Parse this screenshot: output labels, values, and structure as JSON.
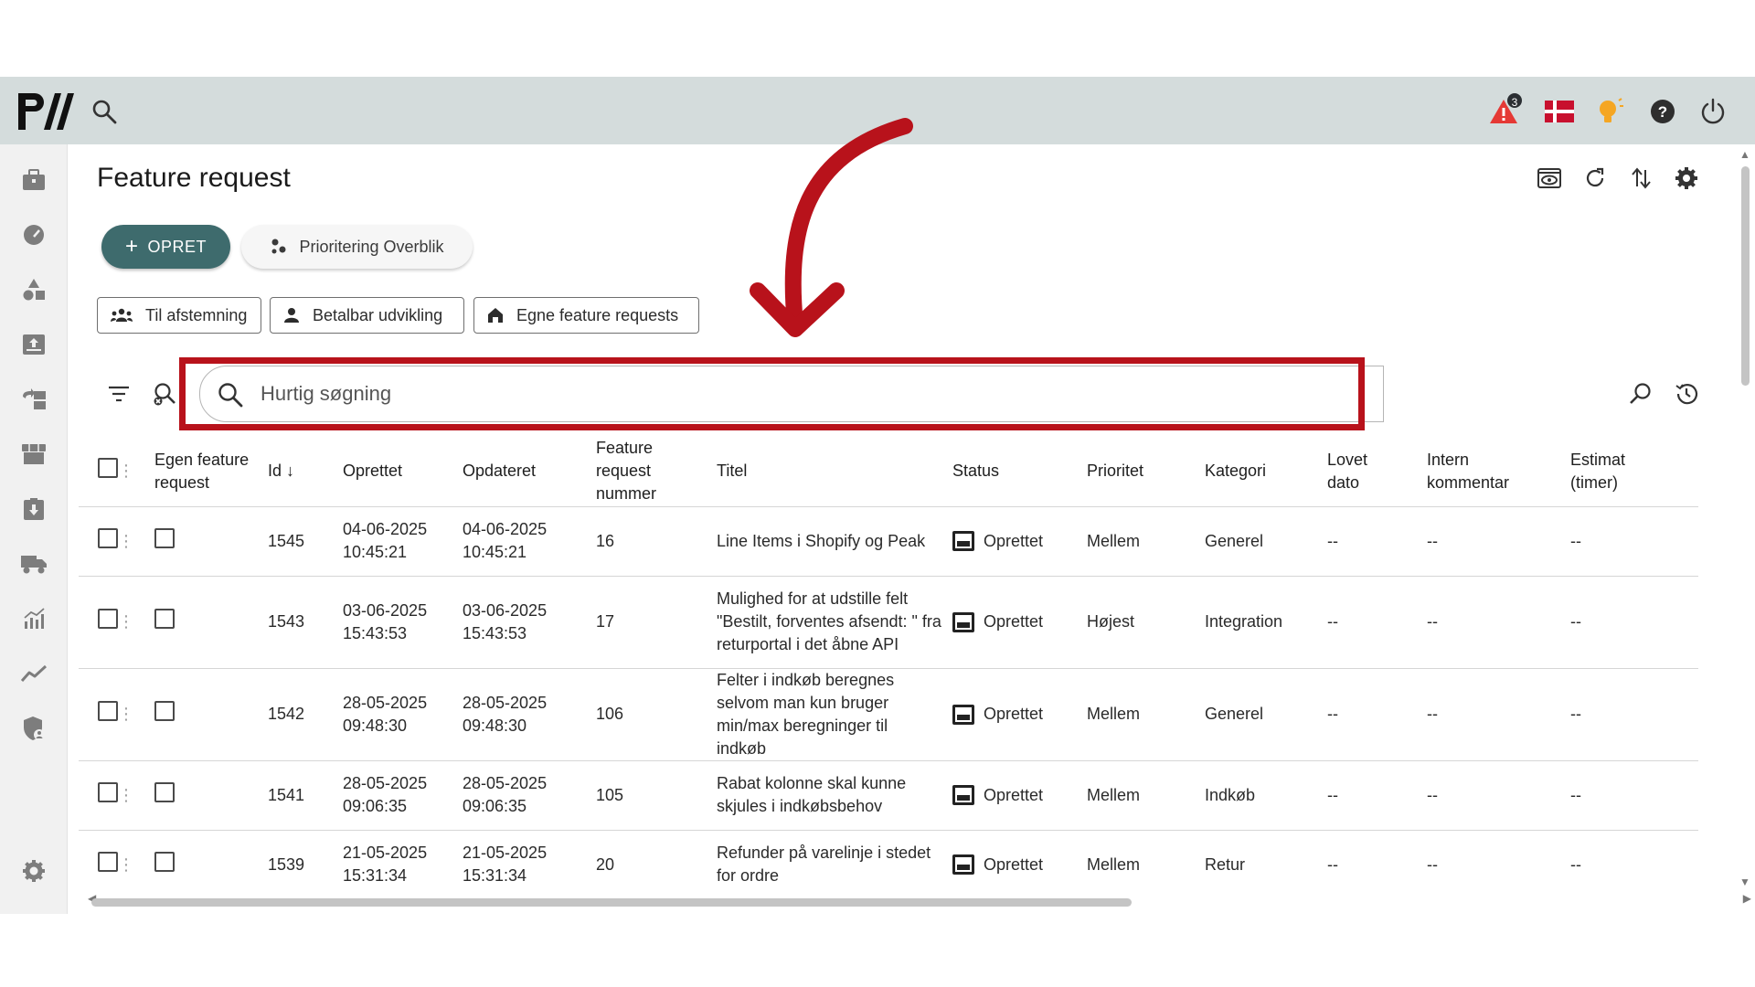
{
  "app": {
    "logo_text": "PW"
  },
  "topbar": {
    "notifications": {
      "count": "3"
    },
    "language": "Danish flag",
    "colors": {
      "bar": "#d4dcdc",
      "alert": "#e53935",
      "bulb": "#f5a623"
    }
  },
  "page": {
    "title": "Feature request"
  },
  "actions": {
    "create_label": "OPRET",
    "overview_label": "Prioritering Overblik"
  },
  "chips": [
    {
      "label": "Til afstemning"
    },
    {
      "label": "Betalbar udvikling"
    },
    {
      "label": "Egne feature requests"
    }
  ],
  "search": {
    "placeholder": "Hurtig søgning",
    "value": ""
  },
  "table": {
    "columns": [
      "Egen feature request",
      "Id",
      "Oprettet",
      "Opdateret",
      "Feature request nummer",
      "Titel",
      "Status",
      "Prioritet",
      "Kategori",
      "Lovet dato",
      "Intern kommentar",
      "Estimat (timer)"
    ],
    "sort_column": "Id",
    "sort_direction": "desc",
    "rows": [
      {
        "id": "1545",
        "created": "04-06-2025 10:45:21",
        "updated": "04-06-2025 10:45:21",
        "number": "16",
        "title": "Line Items i Shopify og Peak",
        "status": "Oprettet",
        "priority": "Mellem",
        "category": "Generel",
        "promised": "--",
        "comment": "--",
        "estimate": "--"
      },
      {
        "id": "1543",
        "created": "03-06-2025 15:43:53",
        "updated": "03-06-2025 15:43:53",
        "number": "17",
        "title": "Mulighed for at udstille felt \"Bestilt, forventes afsendt: \" fra returportal i det åbne API",
        "status": "Oprettet",
        "priority": "Højest",
        "category": "Integration",
        "promised": "--",
        "comment": "--",
        "estimate": "--"
      },
      {
        "id": "1542",
        "created": "28-05-2025 09:48:30",
        "updated": "28-05-2025 09:48:30",
        "number": "106",
        "title": "Felter i indkøb beregnes selvom man kun bruger min/max beregninger til indkøb",
        "status": "Oprettet",
        "priority": "Mellem",
        "category": "Generel",
        "promised": "--",
        "comment": "--",
        "estimate": "--"
      },
      {
        "id": "1541",
        "created": "28-05-2025 09:06:35",
        "updated": "28-05-2025 09:06:35",
        "number": "105",
        "title": "Rabat kolonne skal kunne skjules i indkøbsbehov",
        "status": "Oprettet",
        "priority": "Mellem",
        "category": "Indkøb",
        "promised": "--",
        "comment": "--",
        "estimate": "--"
      },
      {
        "id": "1539",
        "created": "21-05-2025 15:31:34",
        "updated": "21-05-2025 15:31:34",
        "number": "20",
        "title": "Refunder på varelinje i stedet for ordre",
        "status": "Oprettet",
        "priority": "Mellem",
        "category": "Retur",
        "promised": "--",
        "comment": "--",
        "estimate": "--"
      }
    ]
  },
  "annotation": {
    "color": "#b8121b"
  }
}
